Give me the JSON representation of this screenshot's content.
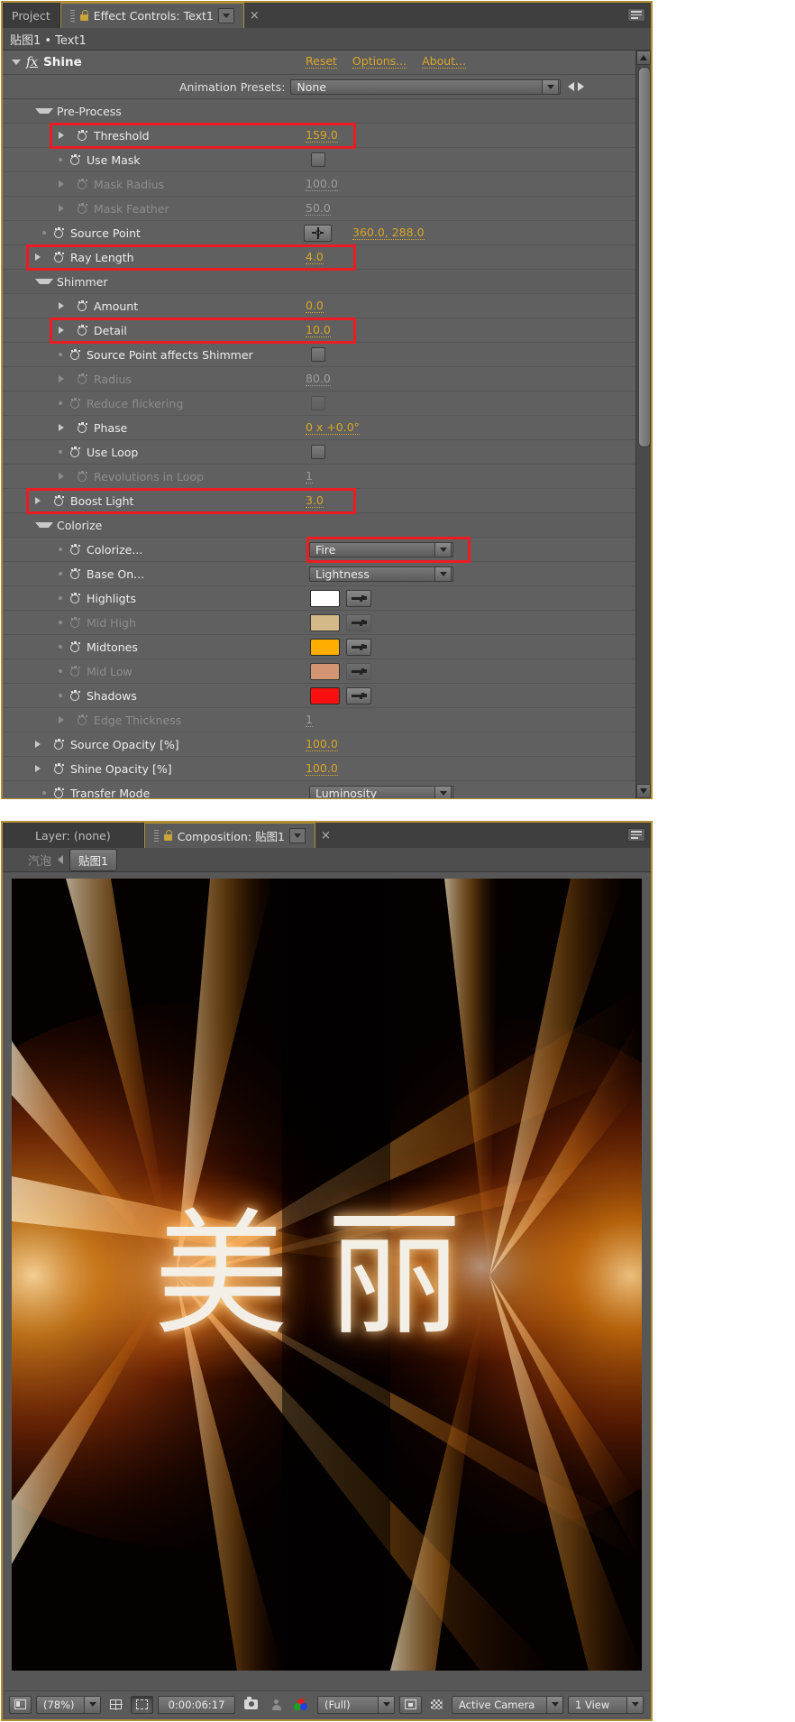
{
  "effect_controls": {
    "tabs": [
      {
        "label": "Project",
        "active": false
      },
      {
        "label": "Effect Controls: Text1",
        "active": true
      }
    ],
    "close_label": "×",
    "breadcrumb": "贴图1 • Text1",
    "effect_name": "Shine",
    "fx_mark": "fx",
    "links": [
      "Reset",
      "Options...",
      "About..."
    ],
    "presets_label": "Animation Presets:",
    "presets_value": "None",
    "rows": [
      {
        "id": "pre-process",
        "label": "Pre-Process",
        "kind": "group",
        "indent": 36,
        "tri": "down"
      },
      {
        "id": "threshold",
        "label": "Threshold",
        "kind": "number",
        "indent": 62,
        "tri": "right",
        "value": "159.0",
        "highlight": true
      },
      {
        "id": "use-mask",
        "label": "Use Mask",
        "kind": "checkbox",
        "indent": 62,
        "tri": "dot",
        "checked": false
      },
      {
        "id": "mask-radius",
        "label": "Mask Radius",
        "kind": "number",
        "indent": 62,
        "tri": "right",
        "value": "100.0",
        "disabled": true
      },
      {
        "id": "mask-feather",
        "label": "Mask Feather",
        "kind": "number",
        "indent": 62,
        "tri": "right",
        "value": "50.0",
        "disabled": true
      },
      {
        "id": "source-point",
        "label": "Source Point",
        "kind": "point",
        "indent": 44,
        "tri": "dot",
        "value": "360.0, 288.0"
      },
      {
        "id": "ray-length",
        "label": "Ray Length",
        "kind": "number",
        "indent": 36,
        "tri": "right",
        "value": "4.0",
        "highlight": true
      },
      {
        "id": "shimmer",
        "label": "Shimmer",
        "kind": "group",
        "indent": 36,
        "tri": "down"
      },
      {
        "id": "amount",
        "label": "Amount",
        "kind": "number",
        "indent": 62,
        "tri": "right",
        "value": "0.0"
      },
      {
        "id": "detail",
        "label": "Detail",
        "kind": "number",
        "indent": 62,
        "tri": "right",
        "value": "10.0",
        "highlight": true
      },
      {
        "id": "source-point-affects-shimmer",
        "label": "Source Point affects Shimmer",
        "kind": "checkbox",
        "indent": 62,
        "tri": "dot",
        "checked": false
      },
      {
        "id": "radius",
        "label": "Radius",
        "kind": "number",
        "indent": 62,
        "tri": "right",
        "value": "80.0",
        "disabled": true
      },
      {
        "id": "reduce-flickering",
        "label": "Reduce flickering",
        "kind": "checkbox",
        "indent": 62,
        "tri": "dot",
        "checked": false,
        "disabled": true
      },
      {
        "id": "phase",
        "label": "Phase",
        "kind": "number",
        "indent": 62,
        "tri": "right",
        "value": "0 x +0.0°"
      },
      {
        "id": "use-loop",
        "label": "Use Loop",
        "kind": "checkbox",
        "indent": 62,
        "tri": "dot",
        "checked": false
      },
      {
        "id": "revolutions-in-loop",
        "label": "Revolutions in Loop",
        "kind": "number",
        "indent": 62,
        "tri": "right",
        "value": "1",
        "disabled": true
      },
      {
        "id": "boost-light",
        "label": "Boost Light",
        "kind": "number",
        "indent": 36,
        "tri": "right",
        "value": "3.0",
        "highlight": true
      },
      {
        "id": "colorize-group",
        "label": "Colorize",
        "kind": "group",
        "indent": 36,
        "tri": "down"
      },
      {
        "id": "colorize",
        "label": "Colorize...",
        "kind": "dropdown",
        "indent": 62,
        "tri": "dot",
        "value": "Fire",
        "highlight": true
      },
      {
        "id": "base-on",
        "label": "Base On...",
        "kind": "dropdown",
        "indent": 62,
        "tri": "dot",
        "value": "Lightness"
      },
      {
        "id": "highligts",
        "label": "Highligts",
        "kind": "color",
        "indent": 62,
        "tri": "dot",
        "color": "#ffffff"
      },
      {
        "id": "mid-high",
        "label": "Mid High",
        "kind": "color",
        "indent": 62,
        "tri": "dot",
        "color": "#ffdc96",
        "disabled": true
      },
      {
        "id": "midtones",
        "label": "Midtones",
        "kind": "color",
        "indent": 62,
        "tri": "dot",
        "color": "#ffae00"
      },
      {
        "id": "mid-low",
        "label": "Mid Low",
        "kind": "color",
        "indent": 62,
        "tri": "dot",
        "color": "#ffa878",
        "disabled": true
      },
      {
        "id": "shadows",
        "label": "Shadows",
        "kind": "color",
        "indent": 62,
        "tri": "dot",
        "color": "#fb0f0f"
      },
      {
        "id": "edge-thickness",
        "label": "Edge Thickness",
        "kind": "number",
        "indent": 62,
        "tri": "right",
        "value": "1",
        "disabled": true
      },
      {
        "id": "source-opacity",
        "label": "Source Opacity [%]",
        "kind": "number",
        "indent": 36,
        "tri": "right",
        "value": "100.0"
      },
      {
        "id": "shine-opacity",
        "label": "Shine Opacity [%]",
        "kind": "number",
        "indent": 36,
        "tri": "right",
        "value": "100.0"
      },
      {
        "id": "transfer-mode",
        "label": "Transfer Mode",
        "kind": "dropdown",
        "indent": 44,
        "tri": "dot",
        "value": "Luminosity"
      }
    ]
  },
  "composition": {
    "tabs": [
      {
        "label": "Layer: (none)",
        "active": false
      },
      {
        "label": "Composition: 贴图1",
        "active": true
      }
    ],
    "close_label": "×",
    "breadcrumb_parent": "汽泡",
    "breadcrumb_current": "贴图1",
    "canvas_text": "美丽",
    "status_bar": {
      "zoom": "(78%)",
      "timecode": "0:00:06:17",
      "resolution": "(Full)",
      "view": "Active Camera",
      "views": "1 View"
    }
  },
  "colors": {
    "accent_yellow": "#d8a628",
    "highlight_red": "#ec1c24",
    "panel_border": "#b08e33"
  }
}
